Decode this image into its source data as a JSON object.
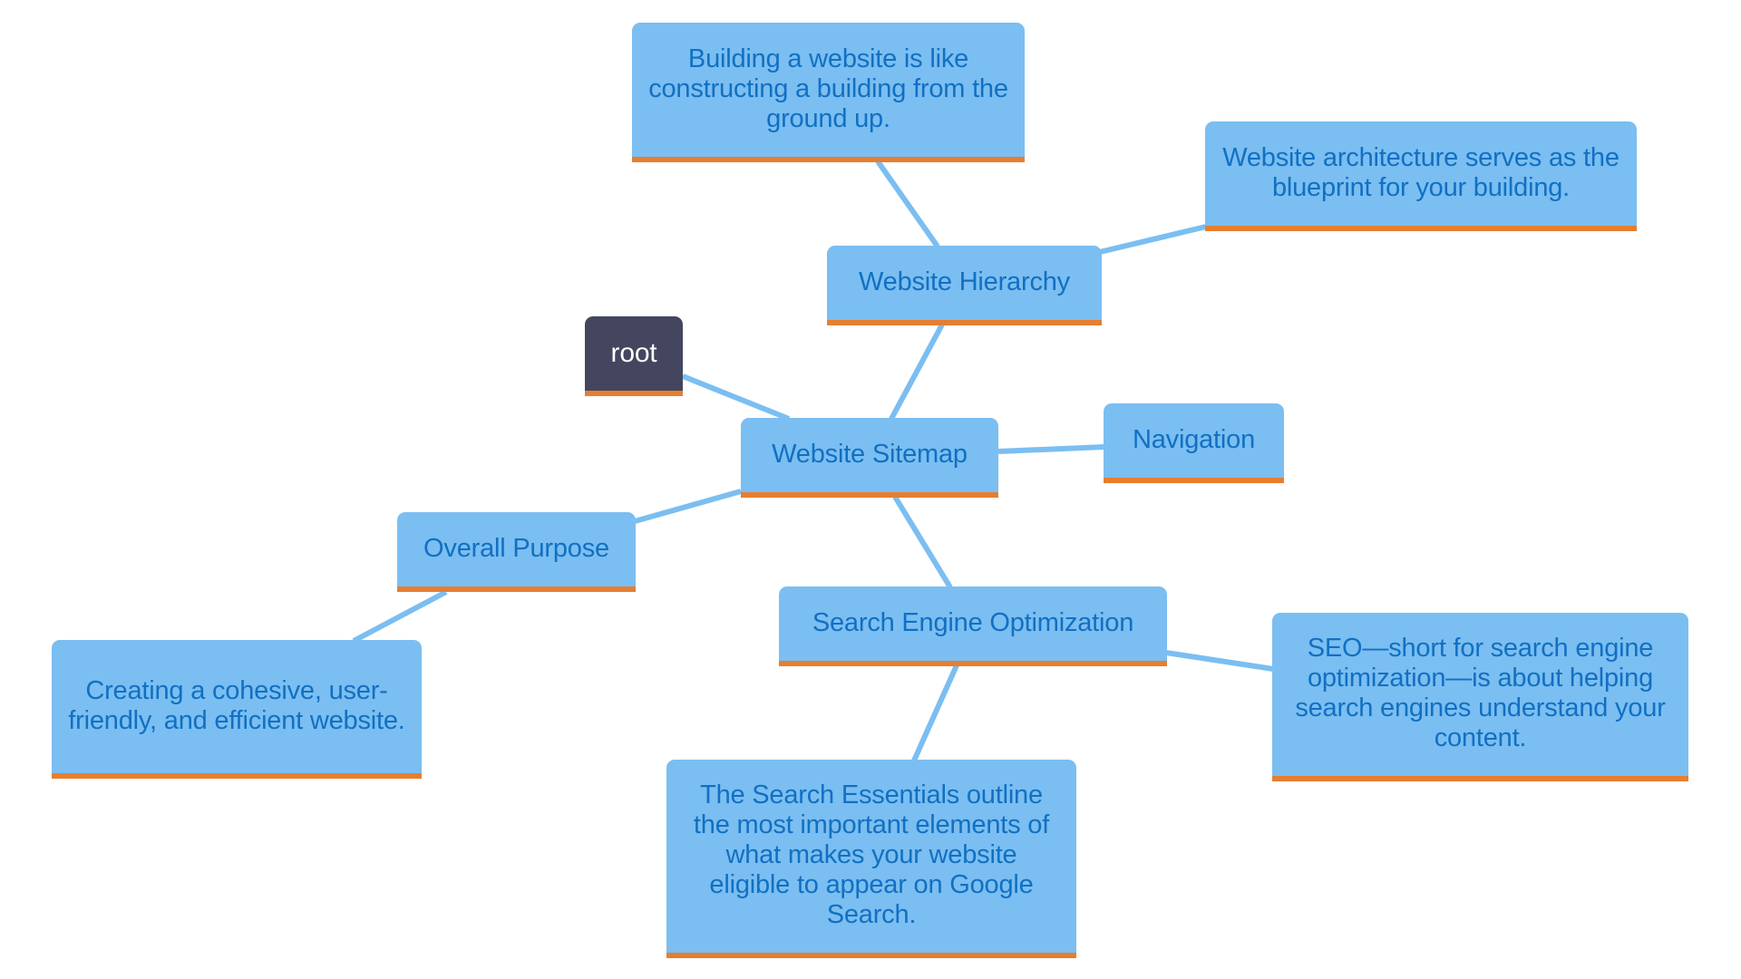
{
  "diagram": {
    "type": "mindmap",
    "colors": {
      "node_fill": "#7bbef1",
      "node_text": "#1170c2",
      "node_underline": "#e67e30",
      "root_fill": "#43465e",
      "root_text": "#ffffff",
      "edge": "#7bbef1"
    },
    "nodes": [
      {
        "id": "root",
        "label": "root"
      },
      {
        "id": "sitemap",
        "label": "Website Sitemap"
      },
      {
        "id": "hierarchy",
        "label": "Website Hierarchy"
      },
      {
        "id": "building",
        "label": "Building a website is like constructing a building from the ground up."
      },
      {
        "id": "architecture",
        "label": "Website architecture serves as the blueprint for your building."
      },
      {
        "id": "navigation",
        "label": "Navigation"
      },
      {
        "id": "purpose",
        "label": "Overall Purpose"
      },
      {
        "id": "creating",
        "label": "Creating a cohesive, user-friendly, and efficient website."
      },
      {
        "id": "seo",
        "label": "Search Engine Optimization"
      },
      {
        "id": "seo_desc",
        "label": "SEO—short for search engine optimization—is about helping search engines understand your content."
      },
      {
        "id": "essentials",
        "label": "The Search Essentials outline the most important elements of what makes your website eligible to appear on Google Search."
      }
    ],
    "edges": [
      {
        "from": "root",
        "to": "sitemap"
      },
      {
        "from": "sitemap",
        "to": "hierarchy"
      },
      {
        "from": "hierarchy",
        "to": "building"
      },
      {
        "from": "hierarchy",
        "to": "architecture"
      },
      {
        "from": "sitemap",
        "to": "navigation"
      },
      {
        "from": "sitemap",
        "to": "purpose"
      },
      {
        "from": "purpose",
        "to": "creating"
      },
      {
        "from": "sitemap",
        "to": "seo"
      },
      {
        "from": "seo",
        "to": "seo_desc"
      },
      {
        "from": "seo",
        "to": "essentials"
      }
    ]
  }
}
